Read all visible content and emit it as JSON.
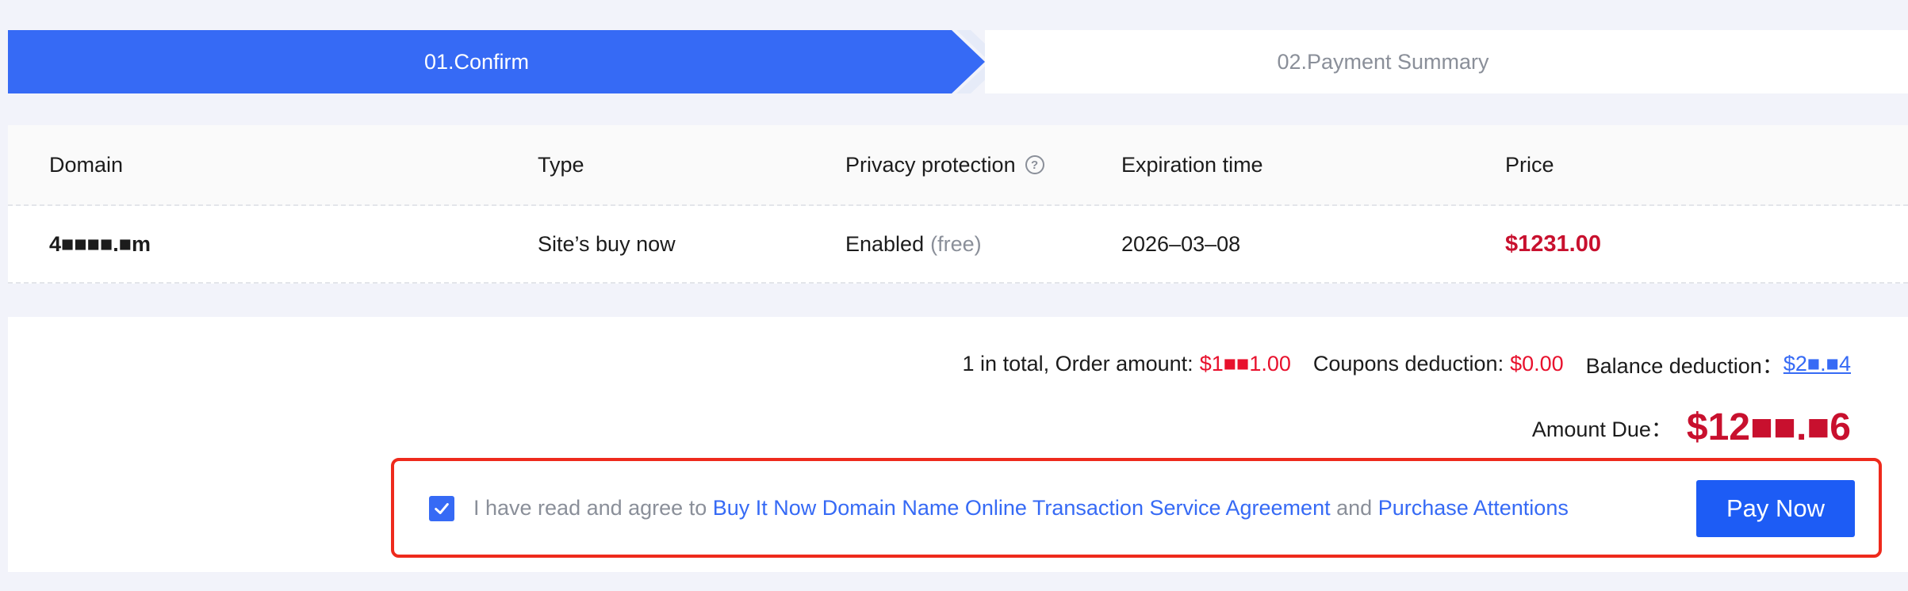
{
  "steps": {
    "step1": "01.Confirm",
    "step2": "02.Payment Summary",
    "colors": {
      "active": "#366af5",
      "inactive_text": "#8a8f99"
    }
  },
  "table": {
    "headers": [
      "Domain",
      "Type",
      "Privacy protection",
      "Expiration time",
      "Price"
    ],
    "help_icon": "question-circle-icon",
    "row": {
      "domain": "4■■■■.■m",
      "type": "Site’s buy now",
      "privacy": "Enabled",
      "privacy_note": "(free)",
      "expiration": "2026–03–08",
      "price": "$1231.00"
    }
  },
  "summary": {
    "total_count": "1 in total, Order amount:",
    "order_amount": "$1■■1.00",
    "coupons_label": "Coupons deduction:",
    "coupons_amount": "$0.00",
    "balance_label": "Balance deduction：",
    "balance_amount": "$2■.■4",
    "due_label": "Amount Due：",
    "due_amount": "$12■■.■6",
    "colors": {
      "price": "#c8102e",
      "accent": "#366af5"
    }
  },
  "agreement": {
    "checked": true,
    "prefix": "I have read and agree to",
    "link1": "Buy It Now Domain Name Online Transaction Service Agreement",
    "joiner": "and",
    "link2": "Purchase Attentions",
    "pay_button": "Pay Now"
  }
}
